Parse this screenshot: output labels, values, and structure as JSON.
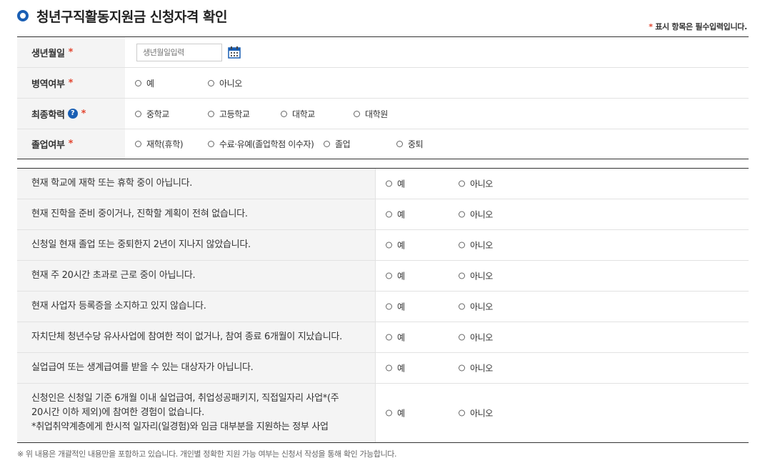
{
  "header": {
    "title": "청년구직활동지원금 신청자격 확인",
    "required_note_star": "*",
    "required_note": "표시 항목은 필수입력입니다."
  },
  "form": {
    "birth": {
      "label": "생년월일",
      "star": "*",
      "placeholder": "생년월일입력"
    },
    "military": {
      "label": "병역여부",
      "star": "*",
      "options": [
        "예",
        "아니오"
      ]
    },
    "education": {
      "label": "최종학력",
      "help": "?",
      "star": "*",
      "options": [
        "중학교",
        "고등학교",
        "대학교",
        "대학원"
      ]
    },
    "graduation": {
      "label": "졸업여부",
      "star": "*",
      "options": [
        "재학(휴학)",
        "수료·유예(졸업학점 이수자)",
        "졸업",
        "중퇴"
      ]
    }
  },
  "questions": {
    "yes": "예",
    "no": "아니오",
    "items": [
      "현재 학교에 재학 또는 휴학 중이 아닙니다.",
      "현재 진학을 준비 중이거나, 진학할 계획이 전혀 없습니다.",
      "신청일 현재 졸업 또는 중퇴한지 2년이 지나지 않았습니다.",
      "현재 주 20시간 초과로 근로 중이 아닙니다.",
      "현재 사업자 등록증을 소지하고 있지 않습니다.",
      "자치단체 청년수당 유사사업에 참여한 적이 없거나, 참여 종료 6개월이 지났습니다.",
      "실업급여 또는 생계급여를 받을 수 있는 대상자가 아닙니다."
    ],
    "last": {
      "line1": "신청인은 신청일 기준 6개월 이내 실업급여, 취업성공패키지, 직접일자리 사업*(주",
      "line2": "20시간 이하 제외)에 참여한 경험이 없습니다.",
      "line3": "*취업취약계층에게 한시적 일자리(일경험)와 임금 대부분을 지원하는 정부 사업"
    }
  },
  "footnote": "※ 위 내용은 개괄적인 내용만을 포함하고 있습니다. 개인별 정확한 지원 가능 여부는 신청서 작성을 통해 확인 가능합니다.",
  "colors": {
    "accent": "#1a5fb4",
    "required": "#e2452f"
  }
}
